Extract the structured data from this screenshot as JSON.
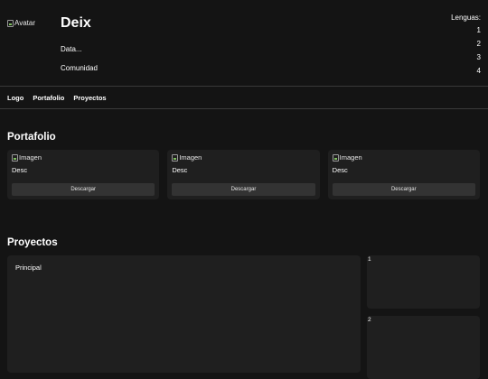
{
  "profile": {
    "avatar_alt": "Avatar",
    "name": "Deix",
    "data": "Data...",
    "community": "Comunidad"
  },
  "languages": {
    "title": "Lenguas:",
    "items": [
      "1",
      "2",
      "3",
      "4"
    ]
  },
  "nav": {
    "items": [
      "Logo",
      "Portafolio",
      "Proyectos"
    ]
  },
  "portfolio": {
    "title": "Portafolio",
    "cards": [
      {
        "image_alt": "Imagen",
        "desc": "Desc",
        "button": "Descargar"
      },
      {
        "image_alt": "Imagen",
        "desc": "Desc",
        "button": "Descargar"
      },
      {
        "image_alt": "Imagen",
        "desc": "Desc",
        "button": "Descargar"
      }
    ]
  },
  "projects": {
    "title": "Proyectos",
    "main_label": "Principal",
    "side": [
      "1",
      "2"
    ]
  }
}
